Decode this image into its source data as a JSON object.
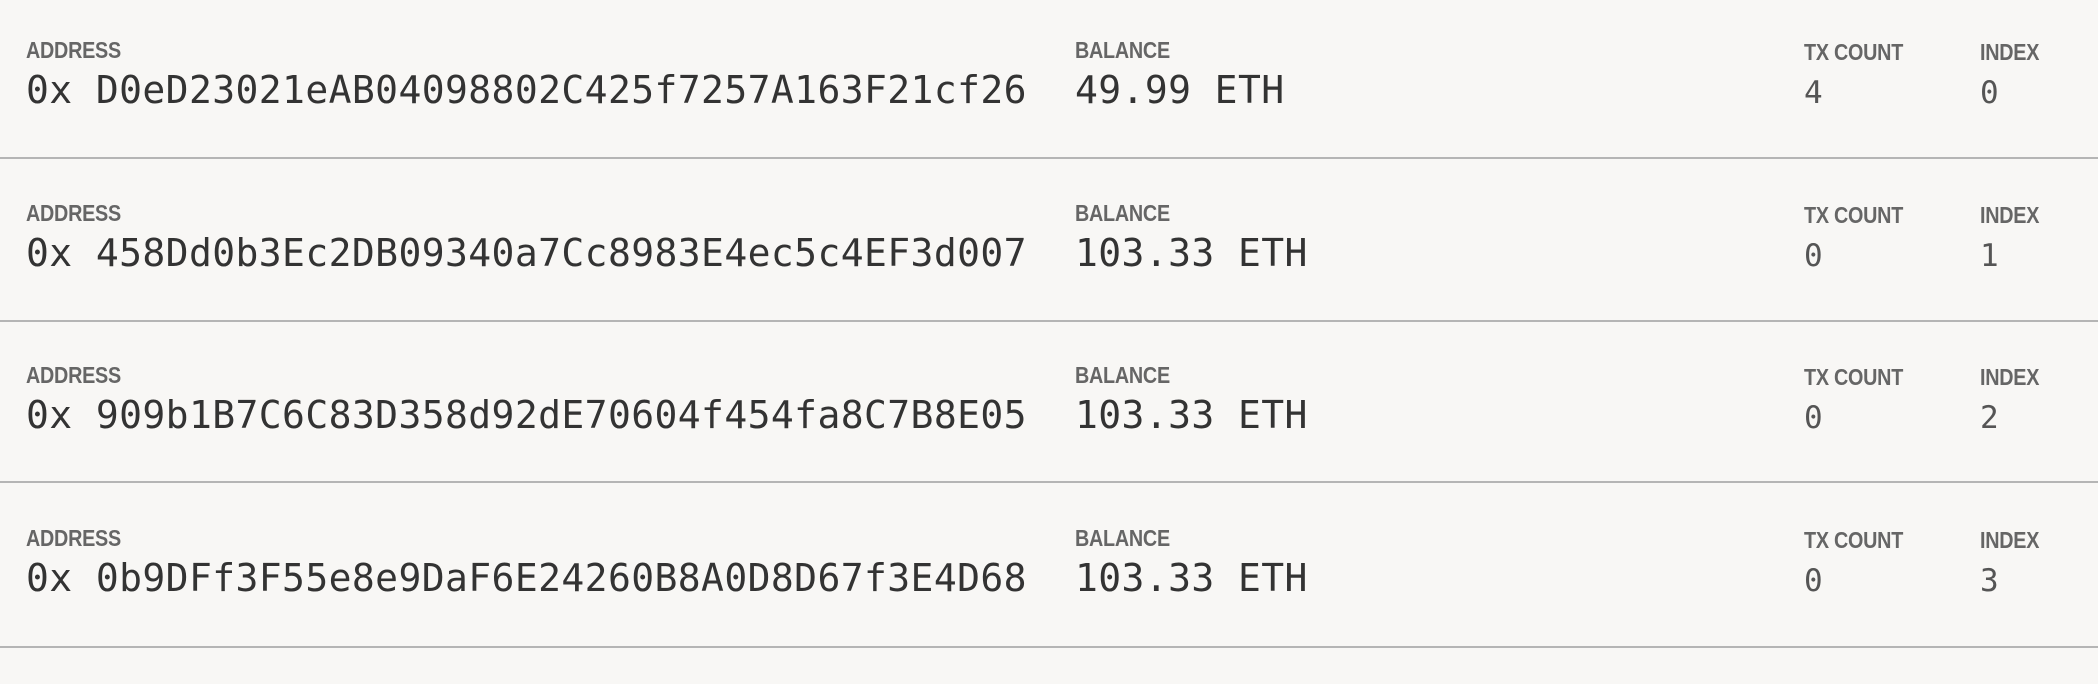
{
  "labels": {
    "address": "ADDRESS",
    "balance": "BALANCE",
    "tx_count": "TX COUNT",
    "index": "INDEX"
  },
  "accounts": [
    {
      "address": "0x D0eD23021eAB04098802C425f7257A163F21cf26",
      "balance": "49.99 ETH",
      "tx_count": "4",
      "index": "0"
    },
    {
      "address": "0x 458Dd0b3Ec2DB09340a7Cc8983E4ec5c4EF3d007",
      "balance": "103.33 ETH",
      "tx_count": "0",
      "index": "1"
    },
    {
      "address": "0x 909b1B7C6C83D358d92dE70604f454fa8C7B8E05",
      "balance": "103.33 ETH",
      "tx_count": "0",
      "index": "2"
    },
    {
      "address": "0x 0b9DFf3F55e8e9DaF6E24260B8A0D8D67f3E4D68",
      "balance": "103.33 ETH",
      "tx_count": "0",
      "index": "3"
    }
  ],
  "colors": {
    "background": "#f8f7f5",
    "divider": "#b5b5b5",
    "label": "#666666",
    "value": "#333333"
  }
}
